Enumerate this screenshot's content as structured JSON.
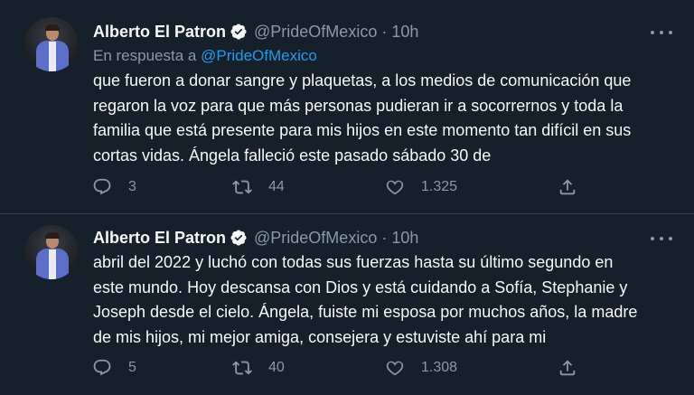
{
  "tweets": [
    {
      "name": "Alberto El Patron",
      "handle": "@PrideOfMexico",
      "separator": "·",
      "time": "10h",
      "reply_prefix": "En respuesta a",
      "reply_mention": "@PrideOfMexico",
      "lines": [
        "que fueron a donar sangre y plaquetas, a los medios de comunicación que",
        "regaron la voz para que más personas pudieran ir a socorrernos y toda la",
        "familia que está presente para mis hijos en este momento tan difícil en sus",
        "cortas vidas. Ángela falleció este pasado sábado 30 de"
      ],
      "replies": "3",
      "retweets": "44",
      "likes": "1.325"
    },
    {
      "name": "Alberto El Patron",
      "handle": "@PrideOfMexico",
      "separator": "·",
      "time": "10h",
      "lines": [
        "abril del 2022 y luchó con todas sus fuerzas hasta su último segundo en",
        "este mundo. Hoy descansa con Dios y está cuidando a Sofía, Stephanie y",
        "Joseph desde el cielo. Ángela, fuiste mi esposa por muchos años, la madre",
        "de mis hijos, mi mejor amiga, consejera y estuviste ahí para mi"
      ],
      "replies": "5",
      "retweets": "40",
      "likes": "1.308"
    }
  ],
  "icons": {
    "verified": "verified-badge-icon",
    "more": "more-icon",
    "reply": "reply-icon",
    "retweet": "retweet-icon",
    "like": "heart-icon",
    "share": "share-icon"
  },
  "colors": {
    "background": "#15202b",
    "text": "#f7f9f9",
    "muted": "#8b98a5",
    "accent": "#1d9bf0",
    "divider": "#38444d"
  }
}
